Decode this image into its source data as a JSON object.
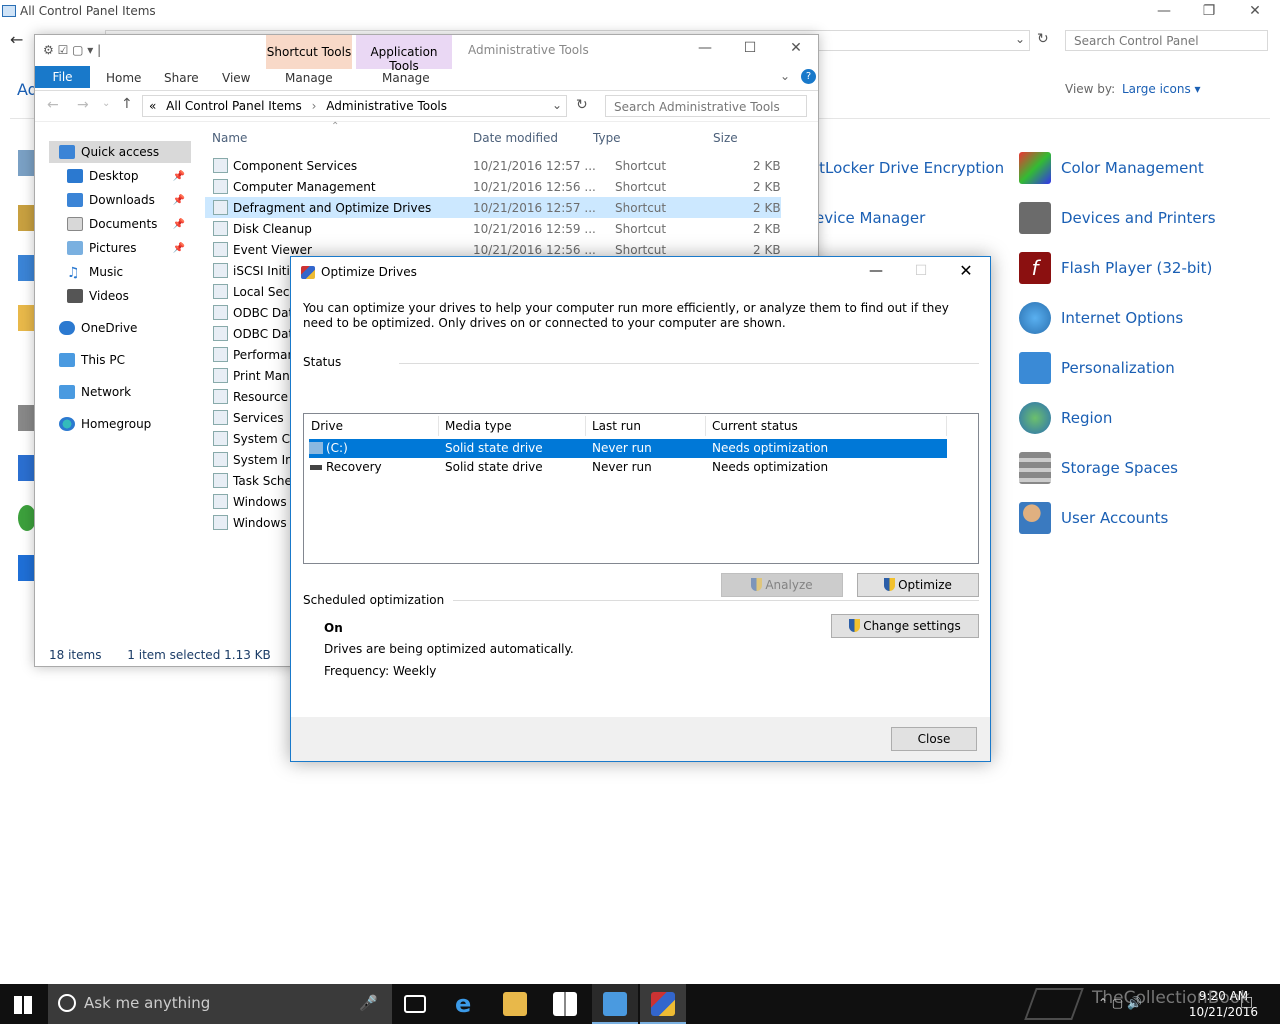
{
  "control_panel": {
    "title": "All Control Panel Items",
    "search_placeholder": "Search Control Panel",
    "heading_fragment": "Ad",
    "view_by_label": "View by:",
    "view_by_value": "Large icons",
    "items_right": [
      "Color Management",
      "Devices and Printers",
      "Flash Player (32-bit)",
      "Internet Options",
      "Personalization",
      "Region",
      "Storage Spaces",
      "User Accounts"
    ],
    "items_middle": [
      "itLocker Drive Encryption",
      "evice Manager"
    ]
  },
  "explorer": {
    "contextual_tabs": [
      "Shortcut Tools",
      "Application Tools"
    ],
    "title": "Administrative Tools",
    "ribbon_tabs": [
      "File",
      "Home",
      "Share",
      "View",
      "Manage",
      "Manage"
    ],
    "breadcrumb": [
      "All Control Panel Items",
      "Administrative Tools"
    ],
    "breadcrumb_prefix": "«",
    "search_placeholder": "Search Administrative Tools",
    "nav": [
      {
        "label": "Quick access",
        "pinned": false
      },
      {
        "label": "Desktop",
        "pinned": true
      },
      {
        "label": "Downloads",
        "pinned": true
      },
      {
        "label": "Documents",
        "pinned": true
      },
      {
        "label": "Pictures",
        "pinned": true
      },
      {
        "label": "Music",
        "pinned": false
      },
      {
        "label": "Videos",
        "pinned": false
      },
      {
        "label": "OneDrive",
        "pinned": false
      },
      {
        "label": "This PC",
        "pinned": false
      },
      {
        "label": "Network",
        "pinned": false
      },
      {
        "label": "Homegroup",
        "pinned": false
      }
    ],
    "columns": [
      "Name",
      "Date modified",
      "Type",
      "Size"
    ],
    "files": [
      {
        "name": "Component Services",
        "date": "10/21/2016 12:57 ...",
        "type": "Shortcut",
        "size": "2 KB"
      },
      {
        "name": "Computer Management",
        "date": "10/21/2016 12:56 ...",
        "type": "Shortcut",
        "size": "2 KB"
      },
      {
        "name": "Defragment and Optimize Drives",
        "date": "10/21/2016 12:57 ...",
        "type": "Shortcut",
        "size": "2 KB",
        "selected": true
      },
      {
        "name": "Disk Cleanup",
        "date": "10/21/2016 12:59 ...",
        "type": "Shortcut",
        "size": "2 KB"
      },
      {
        "name": "Event Viewer",
        "date": "10/21/2016 12:56 ...",
        "type": "Shortcut",
        "size": "2 KB"
      },
      {
        "name": "iSCSI Initiat",
        "date": "",
        "type": "",
        "size": ""
      },
      {
        "name": "Local Secu",
        "date": "",
        "type": "",
        "size": ""
      },
      {
        "name": "ODBC Data",
        "date": "",
        "type": "",
        "size": ""
      },
      {
        "name": "ODBC Data",
        "date": "",
        "type": "",
        "size": ""
      },
      {
        "name": "Performan",
        "date": "",
        "type": "",
        "size": ""
      },
      {
        "name": "Print Mana",
        "date": "",
        "type": "",
        "size": ""
      },
      {
        "name": "Resource M",
        "date": "",
        "type": "",
        "size": ""
      },
      {
        "name": "Services",
        "date": "",
        "type": "",
        "size": ""
      },
      {
        "name": "System Co",
        "date": "",
        "type": "",
        "size": ""
      },
      {
        "name": "System Info",
        "date": "",
        "type": "",
        "size": ""
      },
      {
        "name": "Task Sched",
        "date": "",
        "type": "",
        "size": ""
      },
      {
        "name": "Windows F",
        "date": "",
        "type": "",
        "size": ""
      },
      {
        "name": "Windows M",
        "date": "",
        "type": "",
        "size": ""
      }
    ],
    "status": {
      "count": "18 items",
      "selection": "1 item selected  1.13 KB"
    }
  },
  "dialog": {
    "title": "Optimize Drives",
    "description": "You can optimize your drives to help your computer run more efficiently, or analyze them to find out if they need to be optimized. Only drives on or connected to your computer are shown.",
    "status_label": "Status",
    "columns": [
      "Drive",
      "Media type",
      "Last run",
      "Current status"
    ],
    "drives": [
      {
        "drive": "(C:)",
        "media": "Solid state drive",
        "last_run": "Never run",
        "status": "Needs optimization",
        "selected": true
      },
      {
        "drive": "Recovery",
        "media": "Solid state drive",
        "last_run": "Never run",
        "status": "Needs optimization",
        "selected": false
      }
    ],
    "analyze_label": "Analyze",
    "optimize_label": "Optimize",
    "scheduled_label": "Scheduled optimization",
    "schedule_state": "On",
    "schedule_desc": "Drives are being optimized automatically.",
    "frequency": "Frequency: Weekly",
    "change_settings_label": "Change settings",
    "close_label": "Close"
  },
  "taskbar": {
    "search_placeholder": "Ask me anything",
    "time": "9:20 AM",
    "date": "10/21/2016",
    "watermark": "TheCollectionBook"
  }
}
